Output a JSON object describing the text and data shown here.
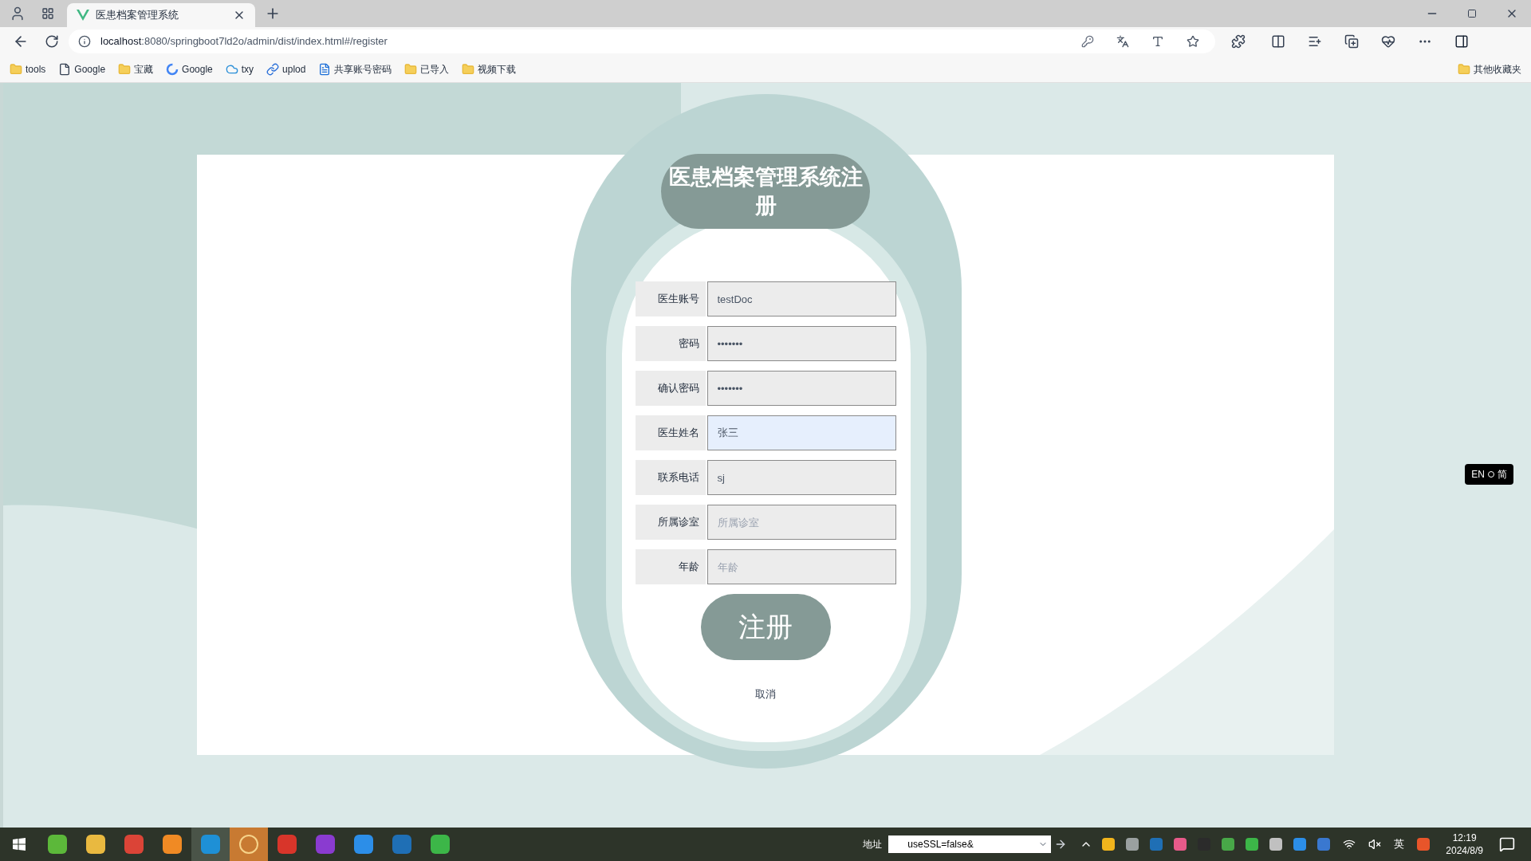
{
  "browser": {
    "tab": {
      "title": "医患档案管理系统"
    },
    "url": {
      "host": "localhost",
      "path": ":8080/springboot7ld2o/admin/dist/index.html#/register"
    },
    "bookmarks": [
      {
        "label": "tools",
        "kind": "folder"
      },
      {
        "label": "Google",
        "kind": "page"
      },
      {
        "label": "宝藏",
        "kind": "folder"
      },
      {
        "label": "Google",
        "kind": "google"
      },
      {
        "label": "txy",
        "kind": "cloud"
      },
      {
        "label": "uplod",
        "kind": "link"
      },
      {
        "label": "共享账号密码",
        "kind": "doc"
      },
      {
        "label": "已导入",
        "kind": "folder"
      },
      {
        "label": "视频下载",
        "kind": "folder"
      }
    ],
    "other_bookmarks": "其他收藏夹"
  },
  "form": {
    "title": "医患档案管理系统注册",
    "fields": [
      {
        "label": "医生账号",
        "value": "testDoc",
        "focused": false
      },
      {
        "label": "密码",
        "value": "•••••••",
        "focused": false
      },
      {
        "label": "确认密码",
        "value": "•••••••",
        "focused": false
      },
      {
        "label": "医生姓名",
        "value": "张三",
        "focused": true
      },
      {
        "label": "联系电话",
        "value": "sj",
        "focused": false
      },
      {
        "label": "所属诊室",
        "placeholder": "所属诊室",
        "focused": false
      },
      {
        "label": "年龄",
        "placeholder": "年龄",
        "focused": false
      }
    ],
    "submit": "注册",
    "cancel": "取消"
  },
  "ime_widget": {
    "mode": "EN",
    "script": "简"
  },
  "taskbar": {
    "address_label": "地址",
    "address_value": "useSSL=false&",
    "ime": "英",
    "time": "12:19",
    "date": "2024/8/9"
  }
}
